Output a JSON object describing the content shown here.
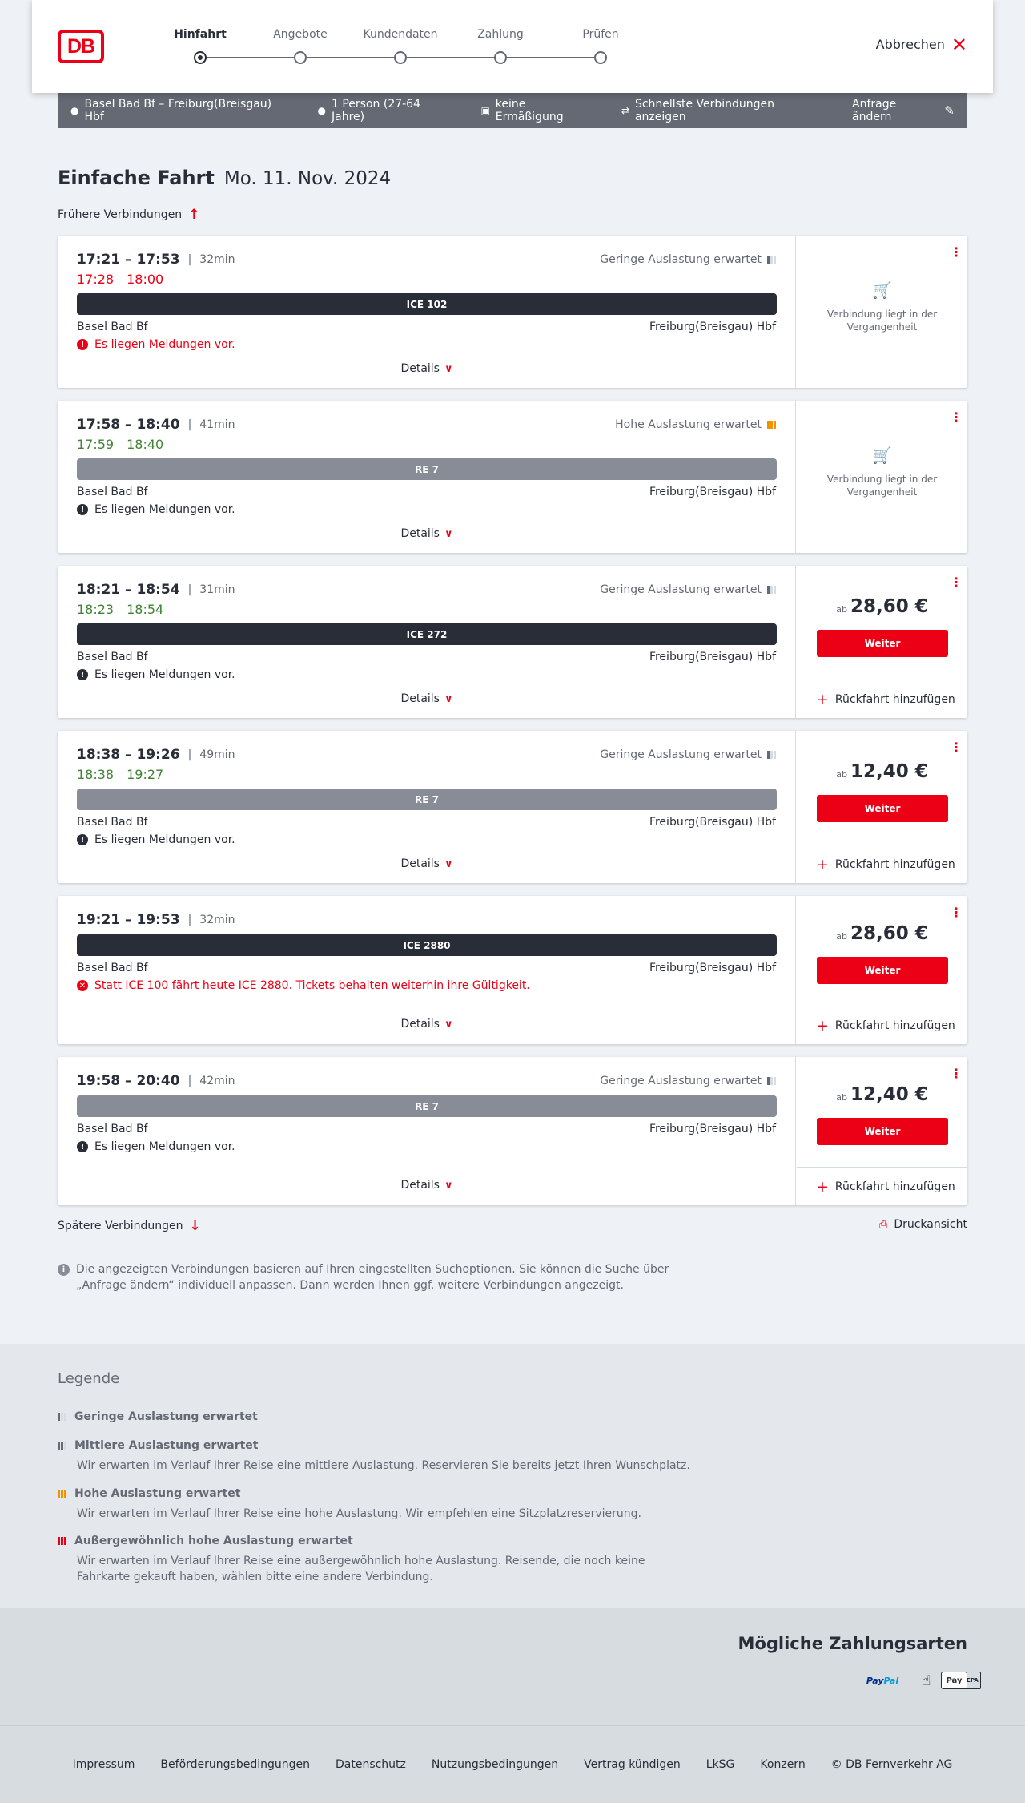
{
  "header": {
    "logo": "DB",
    "cancel_label": "Abbrechen",
    "steps": [
      {
        "label": "Hinfahrt"
      },
      {
        "label": "Angebote"
      },
      {
        "label": "Kundendaten"
      },
      {
        "label": "Zahlung"
      },
      {
        "label": "Prüfen"
      }
    ]
  },
  "search": {
    "route": "Basel Bad Bf – Freiburg(Breisgau) Hbf",
    "persons": "1 Person (27-64 Jahre)",
    "discount": "keine Ermäßigung",
    "fastest": "Schnellste Verbindungen anzeigen",
    "edit": "Anfrage ändern"
  },
  "title": {
    "main": "Einfache Fahrt",
    "date": "Mo. 11. Nov. 2024"
  },
  "earlier": "Frühere Verbindungen",
  "later": "Spätere Verbindungen",
  "print": "Druckansicht",
  "common": {
    "details": "Details",
    "from": "Basel Bad Bf",
    "to": "Freiburg(Breisgau) Hbf",
    "past": "Verbindung liegt in der Vergangenheit",
    "ab": "ab",
    "weiter": "Weiter",
    "return": "Rückfahrt hinzufügen"
  },
  "connections": [
    {
      "times": "17:21 – 17:53",
      "duration": "32min",
      "load": "Geringe Auslastung erwartet",
      "rt_dep": "17:28",
      "rt_arr": "18:00",
      "train": "ICE 102",
      "message": "Es liegen Meldungen vor."
    },
    {
      "times": "17:58 – 18:40",
      "duration": "41min",
      "load": "Hohe Auslastung erwartet",
      "rt_dep": "17:59",
      "rt_arr": "18:40",
      "train": "RE 7",
      "message": "Es liegen Meldungen vor."
    },
    {
      "times": "18:21 – 18:54",
      "duration": "31min",
      "load": "Geringe Auslastung erwartet",
      "rt_dep": "18:23",
      "rt_arr": "18:54",
      "train": "ICE 272",
      "message": "Es liegen Meldungen vor.",
      "price": "28,60 €"
    },
    {
      "times": "18:38 – 19:26",
      "duration": "49min",
      "load": "Geringe Auslastung erwartet",
      "rt_dep": "18:38",
      "rt_arr": "19:27",
      "train": "RE 7",
      "message": "Es liegen Meldungen vor.",
      "price": "12,40 €"
    },
    {
      "times": "19:21 – 19:53",
      "duration": "32min",
      "train": "ICE 2880",
      "message": "Statt ICE 100 fährt heute ICE 2880. Tickets behalten weiterhin ihre Gültigkeit.",
      "price": "28,60 €"
    },
    {
      "times": "19:58 – 20:40",
      "duration": "42min",
      "load": "Geringe Auslastung erwartet",
      "train": "RE 7",
      "message": "Es liegen Meldungen vor.",
      "price": "12,40 €"
    }
  ],
  "info": "Die angezeigten Verbindungen basieren auf Ihren eingestellten Suchoptionen. Sie können die Suche über „Anfrage ändern“ individuell anpassen. Dann werden Ihnen ggf. weitere Verbindungen angezeigt.",
  "legend": {
    "title": "Legende",
    "items": [
      {
        "title": "Geringe Auslastung erwartet"
      },
      {
        "title": "Mittlere Auslastung erwartet",
        "desc": "Wir erwarten im Verlauf Ihrer Reise eine mittlere Auslastung. Reservieren Sie bereits jetzt Ihren Wunschplatz."
      },
      {
        "title": "Hohe Auslastung erwartet",
        "desc": "Wir erwarten im Verlauf Ihrer Reise eine hohe Auslastung. Wir empfehlen eine Sitzplatzreservierung."
      },
      {
        "title": "Außergewöhnlich hohe Auslastung erwartet",
        "desc": "Wir erwarten im Verlauf Ihrer Reise eine außergewöhnlich hohe Auslastung. Reisende, die noch keine Fahrkarte gekauft haben, wählen bitte eine andere Verbindung."
      }
    ]
  },
  "payment": {
    "title": "Mögliche Zahlungsarten",
    "paypal_a": "Pay",
    "paypal_b": "Pal",
    "sepa": "SEPA",
    "applepay": "Pay"
  },
  "footer": [
    "Impressum",
    "Beförderungsbedingungen",
    "Datenschutz",
    "Nutzungsbedingungen",
    "Vertrag kündigen",
    "LkSG",
    "Konzern",
    "© DB Fernverkehr AG"
  ],
  "colors": {
    "brand": "#ec0016",
    "delay": "#ec0016",
    "ontime": "#408335",
    "ice": "#282d37",
    "regional": "#878c96",
    "load_high": "#f39200"
  }
}
